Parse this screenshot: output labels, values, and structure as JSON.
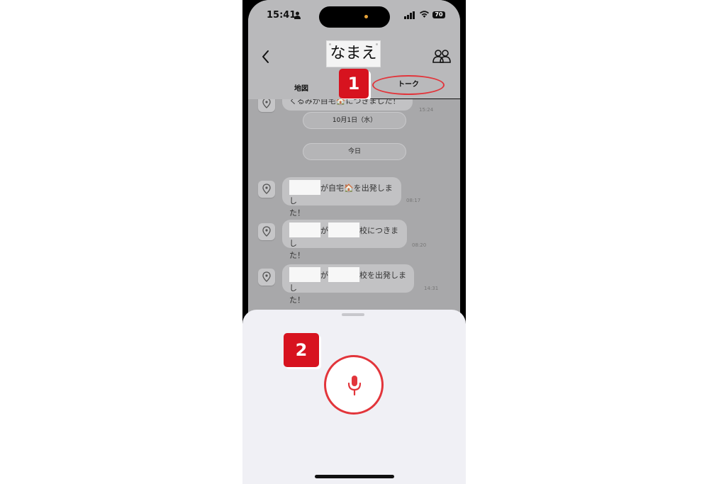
{
  "status_bar": {
    "time": "15:41",
    "battery": "70"
  },
  "header": {
    "title": "なまえ"
  },
  "tabs": {
    "map": "地図",
    "talk": "トーク"
  },
  "badges": {
    "one": "1",
    "two": "2"
  },
  "chat": {
    "partial_message": "くるみが自宅🏠につきました！",
    "partial_time": "15:24",
    "date_separator_1": "10月1日（水）",
    "date_separator_2": "今日",
    "messages": [
      {
        "line1_a": "が自宅🏠を出発しまし",
        "line2": "た！",
        "time": "08:17"
      },
      {
        "mid": "が",
        "line1_b": "校につきまし",
        "line2": "た！",
        "time": "08:20"
      },
      {
        "mid": "が",
        "line1_b": "校を出発しまし",
        "line2": "た！",
        "time": "14:31"
      }
    ]
  },
  "colors": {
    "accent": "#e2353b",
    "badge": "#d7131f"
  }
}
